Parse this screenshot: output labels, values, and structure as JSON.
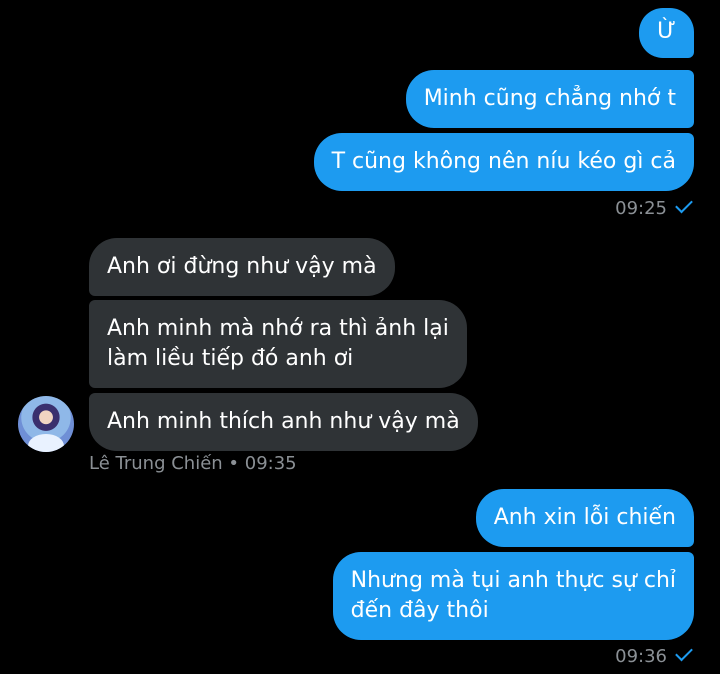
{
  "outgoing_group1": {
    "messages": [
      "Ừ",
      "Minh cũng chẳng nhớ t",
      "T cũng không nên níu kéo gì cả"
    ],
    "time": "09:25"
  },
  "incoming_group": {
    "messages": [
      "Anh ơi đừng như vậy mà",
      "Anh minh mà nhớ ra thì ảnh lại\nlàm liều tiếp đó anh ơi",
      "Anh minh thích anh như vậy mà"
    ],
    "sender": "Lê Trung Chiến",
    "time": "09:35"
  },
  "outgoing_group2": {
    "messages": [
      "Anh xin lỗi chiến",
      "Nhưng mà tụi anh thực sự chỉ\nđến đây thôi"
    ],
    "time": "09:36"
  },
  "colors": {
    "outgoing_bubble": "#1d9bf0",
    "incoming_bubble": "#2f3336",
    "background": "#000000",
    "meta_text": "#8b9095"
  },
  "icons": [
    "read-check-icon",
    "avatar"
  ]
}
